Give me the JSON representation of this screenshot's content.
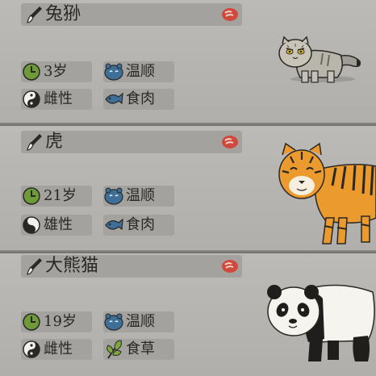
{
  "animals": [
    {
      "name": "兔狲",
      "age": "3岁",
      "temperament": "温顺",
      "sex": "雌性",
      "diet": "食肉"
    },
    {
      "name": "虎",
      "age": "21岁",
      "temperament": "温顺",
      "sex": "雄性",
      "diet": "食肉"
    },
    {
      "name": "大熊猫",
      "age": "19岁",
      "temperament": "温顺",
      "sex": "雌性",
      "diet": "食草"
    }
  ],
  "icons": {
    "edit": "brush-icon",
    "food": "meat-icon",
    "age": "clock-icon",
    "temperament": "face-icon",
    "sex_female": "yin-yang-icon",
    "sex_male": "yin-yang-icon",
    "carnivore": "fish-icon",
    "herbivore": "leaf-icon"
  },
  "colors": {
    "card": "#b7b5b1",
    "chip": "#a4a29e",
    "text": "#2a2825",
    "age_icon": "#6e9a3a",
    "temperament_icon": "#3d6f98",
    "meat_icon": "#cf4a3c"
  }
}
